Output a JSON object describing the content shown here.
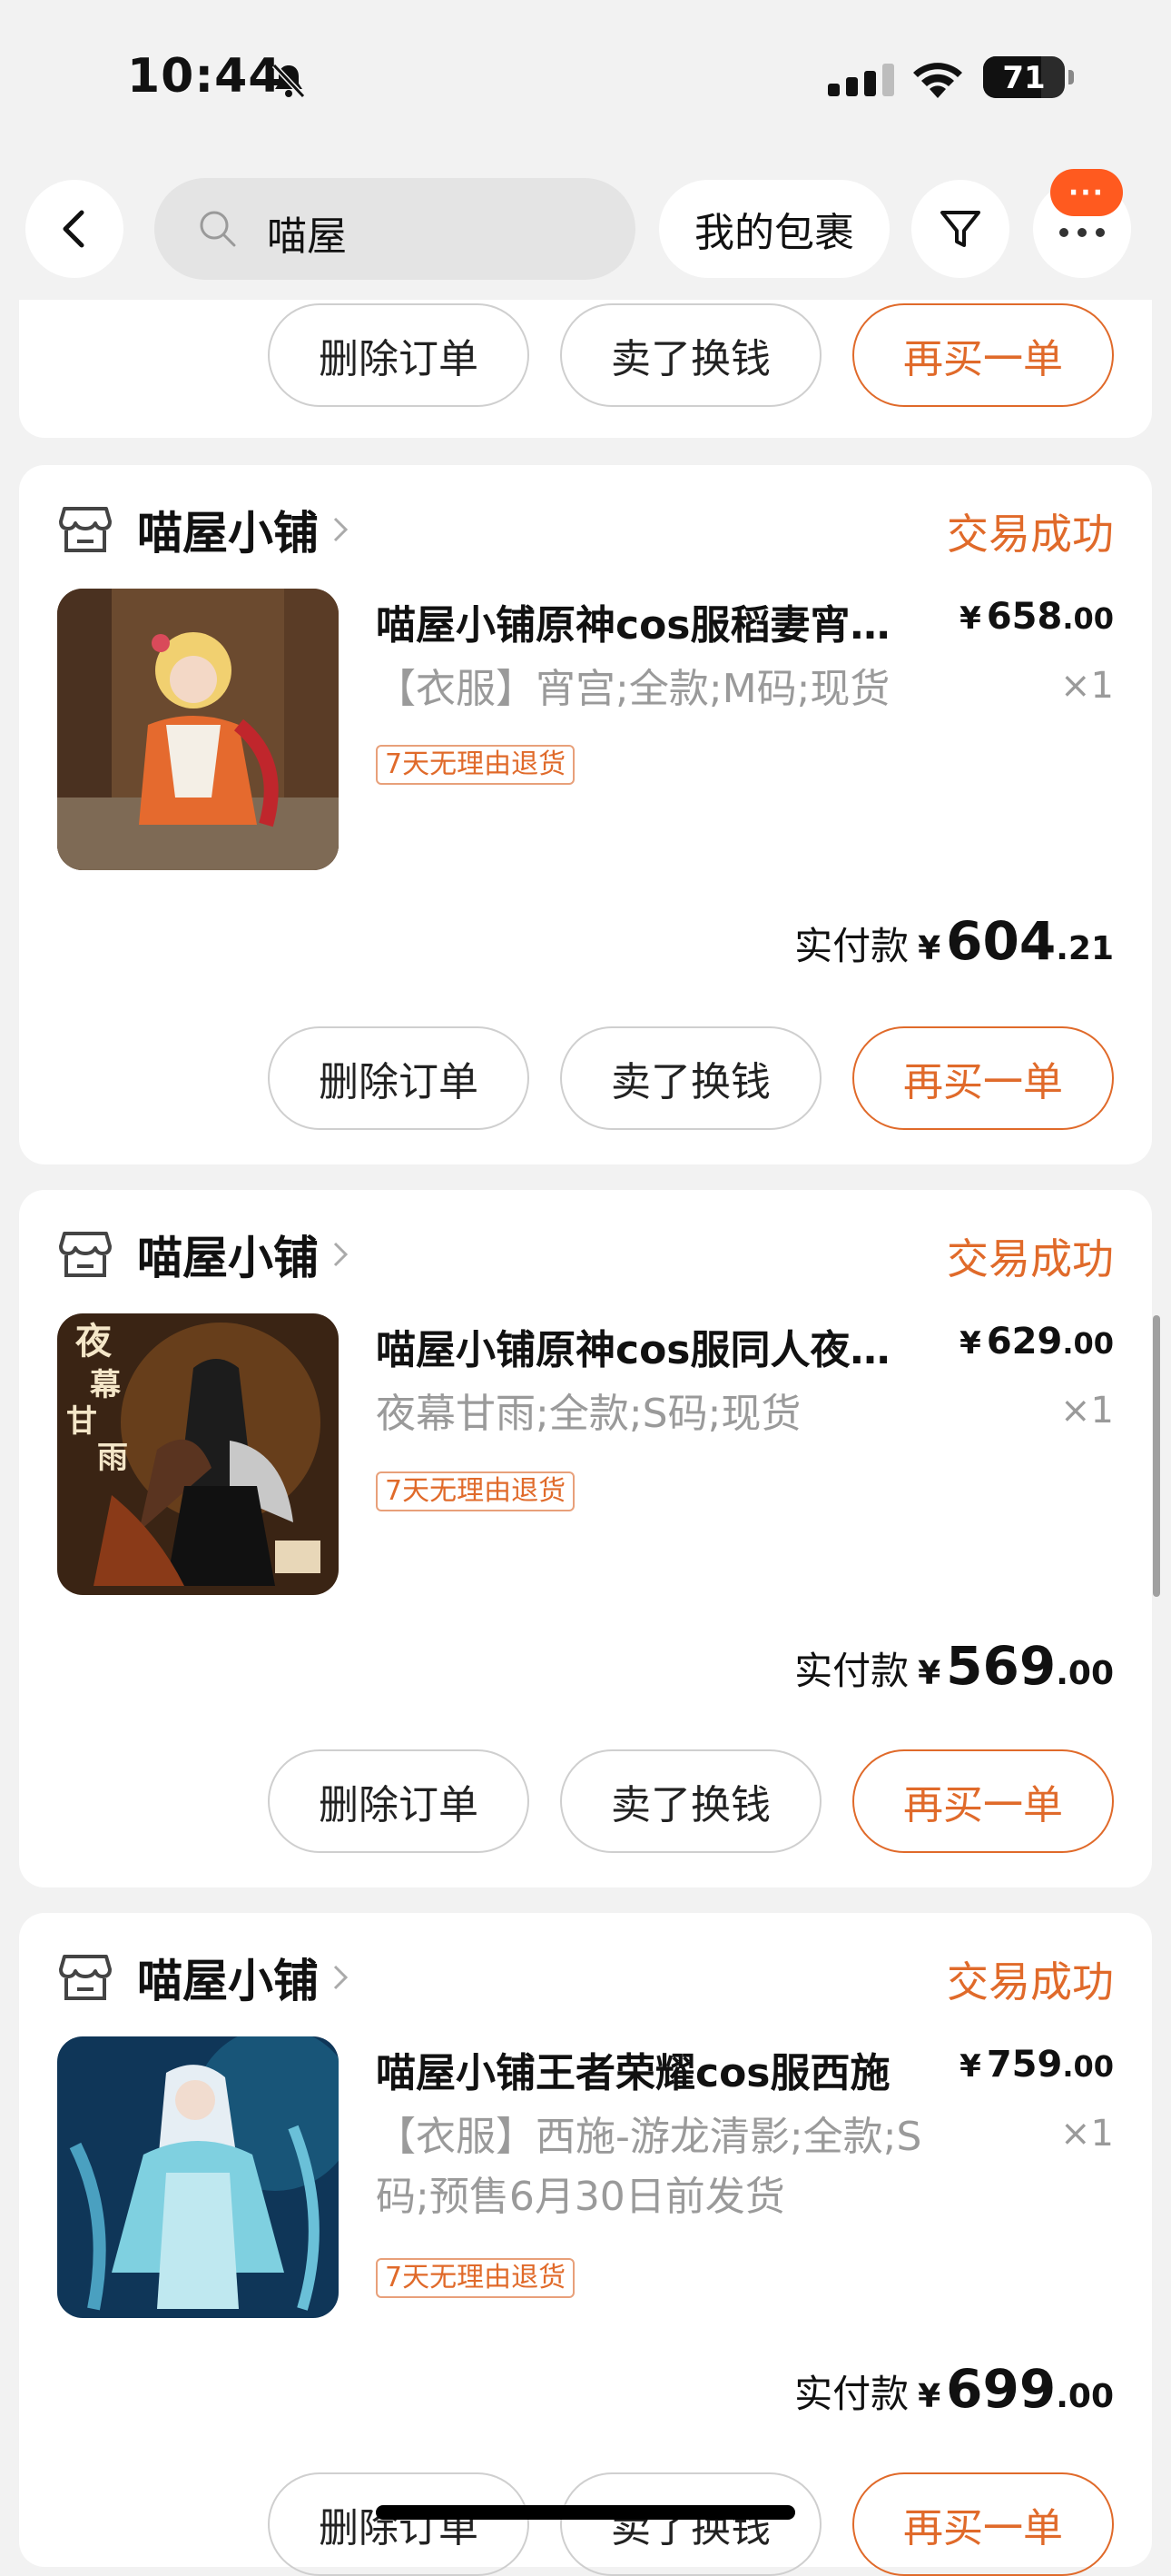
{
  "status_bar": {
    "time": "10:44",
    "battery": "71"
  },
  "top_bar": {
    "search_text": "喵屋",
    "parcel_label": "我的包裹",
    "more_badge": "···"
  },
  "actions": {
    "delete": "删除订单",
    "sell": "卖了换钱",
    "rebuy": "再买一单"
  },
  "orders": [
    {
      "shop": "喵屋小铺",
      "status": "交易成功",
      "title": "喵屋小铺原神cos服稻妻宵宫cos",
      "price_int": "658",
      "price_dec": ".00",
      "spec": "【衣服】宵宫;全款;M码;现货",
      "qty": "×1",
      "tag": "7天无理由退货",
      "paid_label": "实付款",
      "paid_int": "604",
      "paid_dec": ".21"
    },
    {
      "shop": "喵屋小铺",
      "status": "交易成功",
      "title": "喵屋小铺原神cos服同人夜幕甘雨",
      "price_int": "629",
      "price_dec": ".00",
      "spec": "夜幕甘雨;全款;S码;现货",
      "qty": "×1",
      "tag": "7天无理由退货",
      "paid_label": "实付款",
      "paid_int": "569",
      "paid_dec": ".00",
      "thumb_text_1": "夜",
      "thumb_text_2": "幕",
      "thumb_text_3": "甘",
      "thumb_text_4": "雨"
    },
    {
      "shop": "喵屋小铺",
      "status": "交易成功",
      "title": "喵屋小铺王者荣耀cos服西施",
      "price_int": "759",
      "price_dec": ".00",
      "spec": "【衣服】西施-游龙清影;全款;S码;预售6月30日前发货",
      "qty": "×1",
      "tag": "7天无理由退货",
      "paid_label": "实付款",
      "paid_int": "699",
      "paid_dec": ".00"
    }
  ],
  "currency": "¥",
  "colors": {
    "accent": "#e06a2a",
    "background": "#f2f2f2",
    "badge": "#ff5a1f"
  }
}
